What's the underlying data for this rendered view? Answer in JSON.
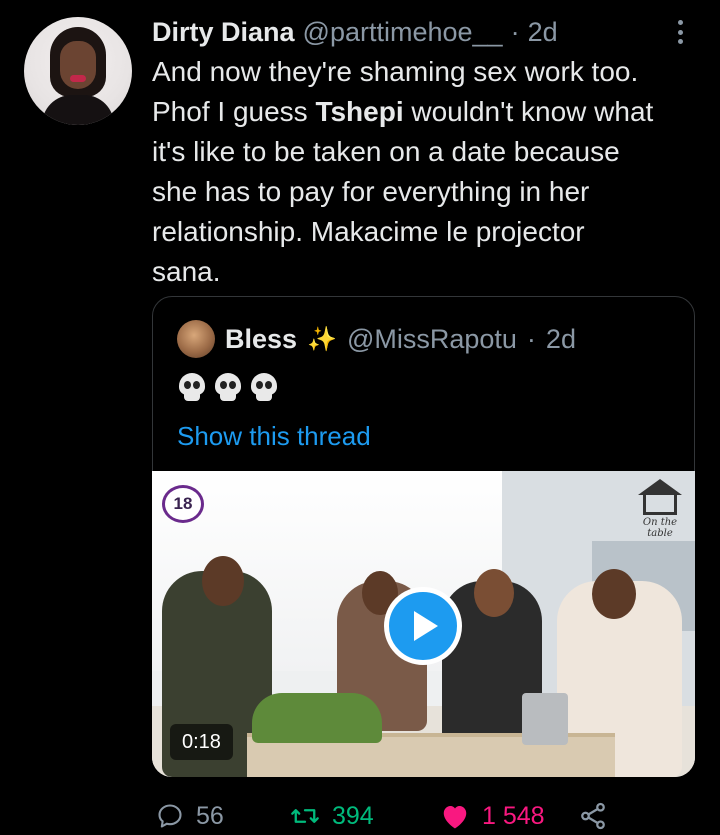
{
  "tweet": {
    "author_name": "Dirty Diana",
    "author_handle": "@parttimehoe__",
    "separator": "·",
    "time": "2d",
    "text_lines": [
      "And now they're shaming sex work too.",
      "Phof I guess ",
      "Tshepi",
      " wouldn't know what",
      "it's like to be taken on a date because",
      "she has to pay for everything in her",
      "relationship. Makacime le projector",
      "sana."
    ]
  },
  "quote": {
    "author_name": "Bless",
    "sparkle": "✨",
    "author_handle": "@MissRapotu",
    "separator": "·",
    "time": "2d",
    "text": "💀💀💀",
    "show_thread_label": "Show this thread",
    "media": {
      "rating_badge": "18",
      "logo_script": "On the table",
      "duration": "0:18"
    }
  },
  "actions": {
    "replies": "56",
    "retweets": "394",
    "likes": "1 548"
  },
  "colors": {
    "background": "#000000",
    "accent": "#1d9bf0",
    "retweet": "#00ba7c",
    "like": "#f91880",
    "secondary_text": "#8b98a5"
  }
}
